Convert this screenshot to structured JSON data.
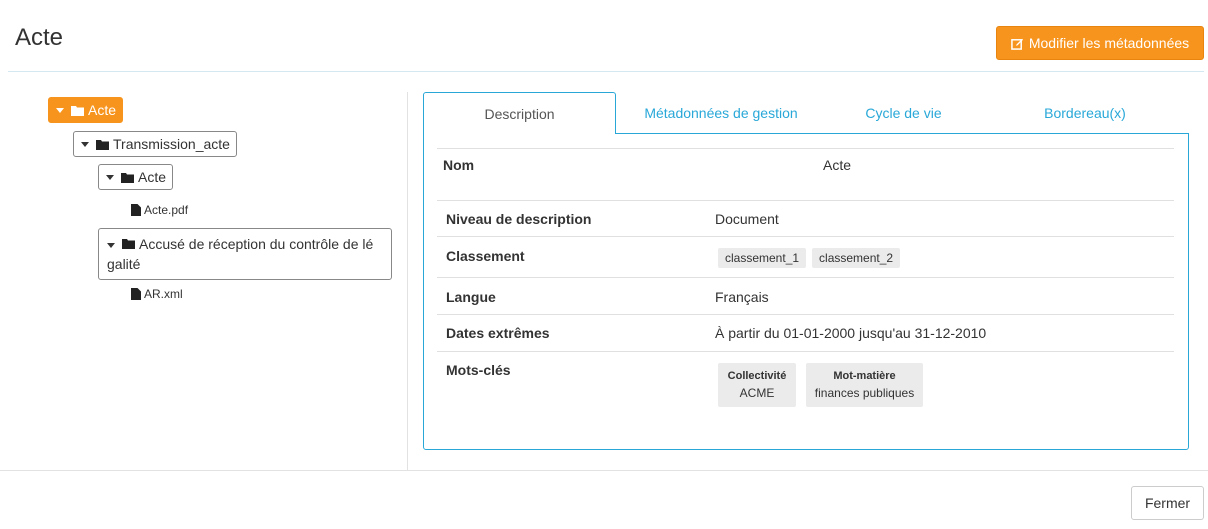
{
  "page": {
    "title": "Acte"
  },
  "header": {
    "edit_label": "Modifier les métadonnées",
    "edit_icon": "edit-icon"
  },
  "tree": {
    "root": "Acte",
    "transmission": "Transmission_acte",
    "acte_folder": "Acte",
    "acte_file": "Acte.pdf",
    "accuse_line1": "Accusé de réception du contrôle de lé",
    "accuse_line2": "galité",
    "ar_file": "AR.xml"
  },
  "tabs": [
    "Description",
    "Métadonnées de gestion",
    "Cycle de vie",
    "Bordereau(x)"
  ],
  "details": {
    "nom_label": "Nom",
    "nom_value": "Acte",
    "niveau_label": "Niveau de description",
    "niveau_value": "Document",
    "classement_label": "Classement",
    "classement_values": [
      "classement_1",
      "classement_2"
    ],
    "langue_label": "Langue",
    "langue_value": "Français",
    "dates_label": "Dates extrêmes",
    "dates_value": "À partir du 01-01-2000 jusqu'au 31-12-2010",
    "motscles_label": "Mots-clés",
    "keywords": [
      {
        "type": "Collectivité",
        "value": "ACME"
      },
      {
        "type": "Mot-matière",
        "value": "finances publiques"
      }
    ]
  },
  "footer": {
    "close_label": "Fermer"
  },
  "colors": {
    "accent": "#f7941d",
    "link": "#29a8d8"
  }
}
